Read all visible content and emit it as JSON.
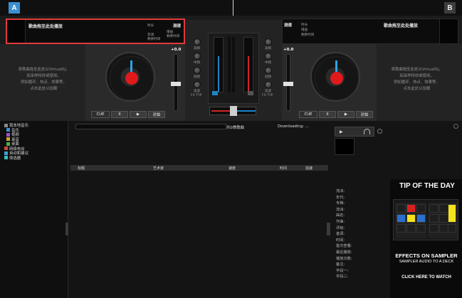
{
  "decks": {
    "a": {
      "letter": "A",
      "title": "歌曲拖至此处播放",
      "bpm_label": "测速",
      "info1": "时长",
      "info2": "增益",
      "info3": "剩余时间",
      "info4": "音调",
      "info5": "剩余时间",
      "pitch_value": "+0.0",
      "empty_msg_line1": "将歌曲拖至此处以VirtualDJ，",
      "empty_msg_line2": "如采样特效或使用，",
      "empty_msg_line3": "例如循环、热点、效果等，",
      "empty_msg_line4": "点击此处以加载",
      "cue_label": "CUE",
      "play_label": "▶",
      "pause_label": "II",
      "sync_label": "对拍"
    },
    "b": {
      "letter": "B",
      "title": "歌曲拖至此处播放",
      "bpm_label": "测速",
      "info1": "时长",
      "info2": "增益",
      "info3": "剩余时间",
      "pitch_value": "+0.0",
      "empty_msg_line1": "将歌曲拖至此处以VirtualDJ，",
      "empty_msg_line2": "如采样特效或使用，",
      "empty_msg_line3": "例如循环、热点、效果等，",
      "empty_msg_line4": "点击此处以加载",
      "cue_label": "CUE",
      "play_label": "▶",
      "pause_label": "II",
      "sync_label": "对拍"
    }
  },
  "mixer": {
    "left_labels": [
      "高频",
      "中频",
      "低频",
      "滤波",
      "FX TYP"
    ],
    "right_labels": [
      "高频",
      "中频",
      "低频",
      "滤波",
      "FX TYP"
    ]
  },
  "tree": {
    "items": [
      {
        "label": "我本地音乐",
        "color": "#888888"
      },
      {
        "label": "音乐",
        "color": "#3a8fd0"
      },
      {
        "label": "视频",
        "color": "#a050d0"
      },
      {
        "label": "录音",
        "color": "#d0a030"
      },
      {
        "label": "桌面",
        "color": "#4ab04a"
      },
      {
        "label": "网络电台",
        "color": "#d04040"
      },
      {
        "label": "自动和建议",
        "color": "#40a0d0"
      },
      {
        "label": "筛选器",
        "color": "#30c0c0"
      }
    ]
  },
  "browser": {
    "status_count": "共0首歌曲",
    "downloading": "Downloading: ...",
    "columns": [
      "标题",
      "艺术家",
      "速度",
      "时间",
      "拍速"
    ]
  },
  "info_panel": {
    "fields": [
      "流派:",
      "年代:",
      "专辑:",
      "流派:",
      "曲名:",
      "作曲:",
      "评级:",
      "音调:",
      "时间:",
      "首次查看:",
      "最近播放:",
      "播放次数:",
      "备注:",
      "字段一:",
      "字段二:"
    ]
  },
  "tip": {
    "title": "TIP OF THE DAY",
    "headline": "EFFECTS ON SAMPLER",
    "subline": "SAMPLER AUDIO TO A DECK",
    "cta": "CLICK HERE TO WATCH"
  },
  "colors": {
    "accent_blue": "#2da5e6",
    "accent_red": "#e0191b",
    "highlight_border": "#e23a3a",
    "tip_yellow": "#f3e21c"
  }
}
